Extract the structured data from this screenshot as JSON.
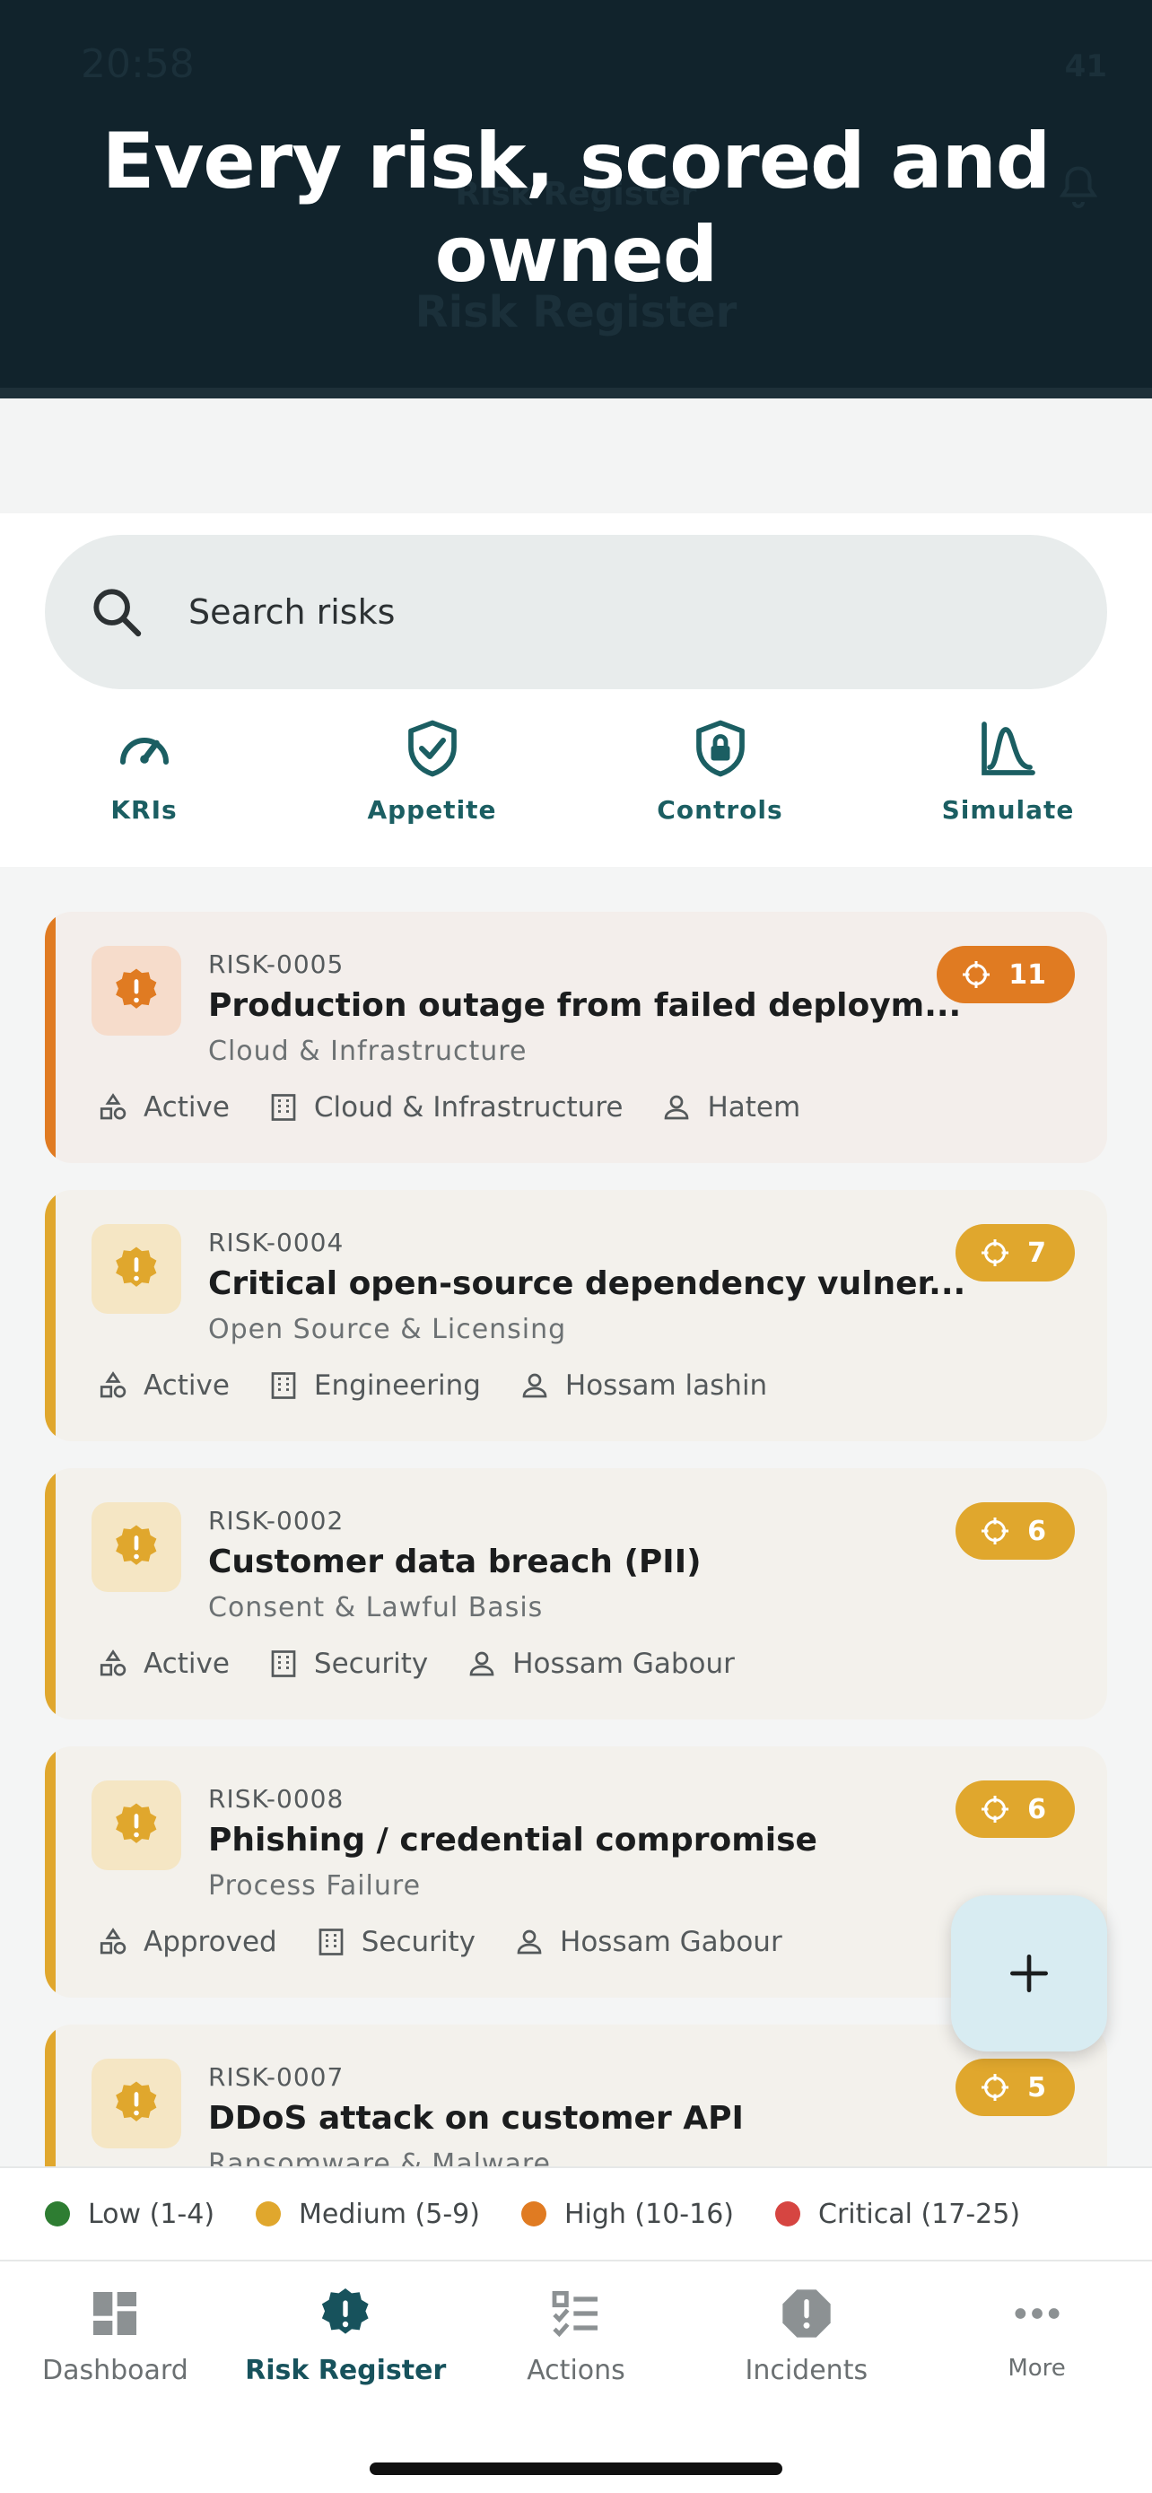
{
  "banner": {
    "headline": "Every risk, scored and owned",
    "status_time": "20:58",
    "battery": "41",
    "ghost_subtitle": "Risk Register",
    "ghost_title": "Risk Register"
  },
  "search": {
    "placeholder": "Search risks",
    "icon": "search-icon"
  },
  "quick_actions": [
    {
      "label": "KRIs",
      "icon": "gauge-icon"
    },
    {
      "label": "Appetite",
      "icon": "shield-check-icon"
    },
    {
      "label": "Controls",
      "icon": "shield-lock-icon"
    },
    {
      "label": "Simulate",
      "icon": "distribution-icon"
    }
  ],
  "risks": [
    {
      "id": "RISK-0005",
      "title": "Production outage from failed deploym...",
      "category": "Cloud & Infrastructure",
      "status": "Active",
      "department": "Cloud & Infrastructure",
      "owner": "Hatem",
      "score": "11",
      "level": "High"
    },
    {
      "id": "RISK-0004",
      "title": "Critical open-source dependency vulner...",
      "category": "Open Source & Licensing",
      "status": "Active",
      "department": "Engineering",
      "owner": "Hossam lashin",
      "score": "7",
      "level": "Medium"
    },
    {
      "id": "RISK-0002",
      "title": "Customer data breach (PII)",
      "category": "Consent & Lawful Basis",
      "status": "Active",
      "department": "Security",
      "owner": "Hossam Gabour",
      "score": "6",
      "level": "Medium"
    },
    {
      "id": "RISK-0008",
      "title": "Phishing / credential compromise",
      "category": "Process Failure",
      "status": "Approved",
      "department": "Security",
      "owner": "Hossam Gabour",
      "score": "6",
      "level": "Medium"
    },
    {
      "id": "RISK-0007",
      "title": "DDoS attack on customer API",
      "category": "Ransomware & Malware",
      "status": "",
      "department": "",
      "owner": "",
      "score": "5",
      "level": "Medium"
    }
  ],
  "legend": [
    {
      "label": "Low (1-4)",
      "color": "#2e7d32"
    },
    {
      "label": "Medium (5-9)",
      "color": "#e0a72d"
    },
    {
      "label": "High (10-16)",
      "color": "#e07b22"
    },
    {
      "label": "Critical (17-25)",
      "color": "#d64541"
    }
  ],
  "nav": {
    "dashboard": "Dashboard",
    "risk_register": "Risk Register",
    "actions": "Actions",
    "incidents": "Incidents",
    "more": "More"
  },
  "colors": {
    "accent": "#17525c",
    "high": "#e07b22",
    "medium": "#e0a72d",
    "banner": "#11232c"
  }
}
